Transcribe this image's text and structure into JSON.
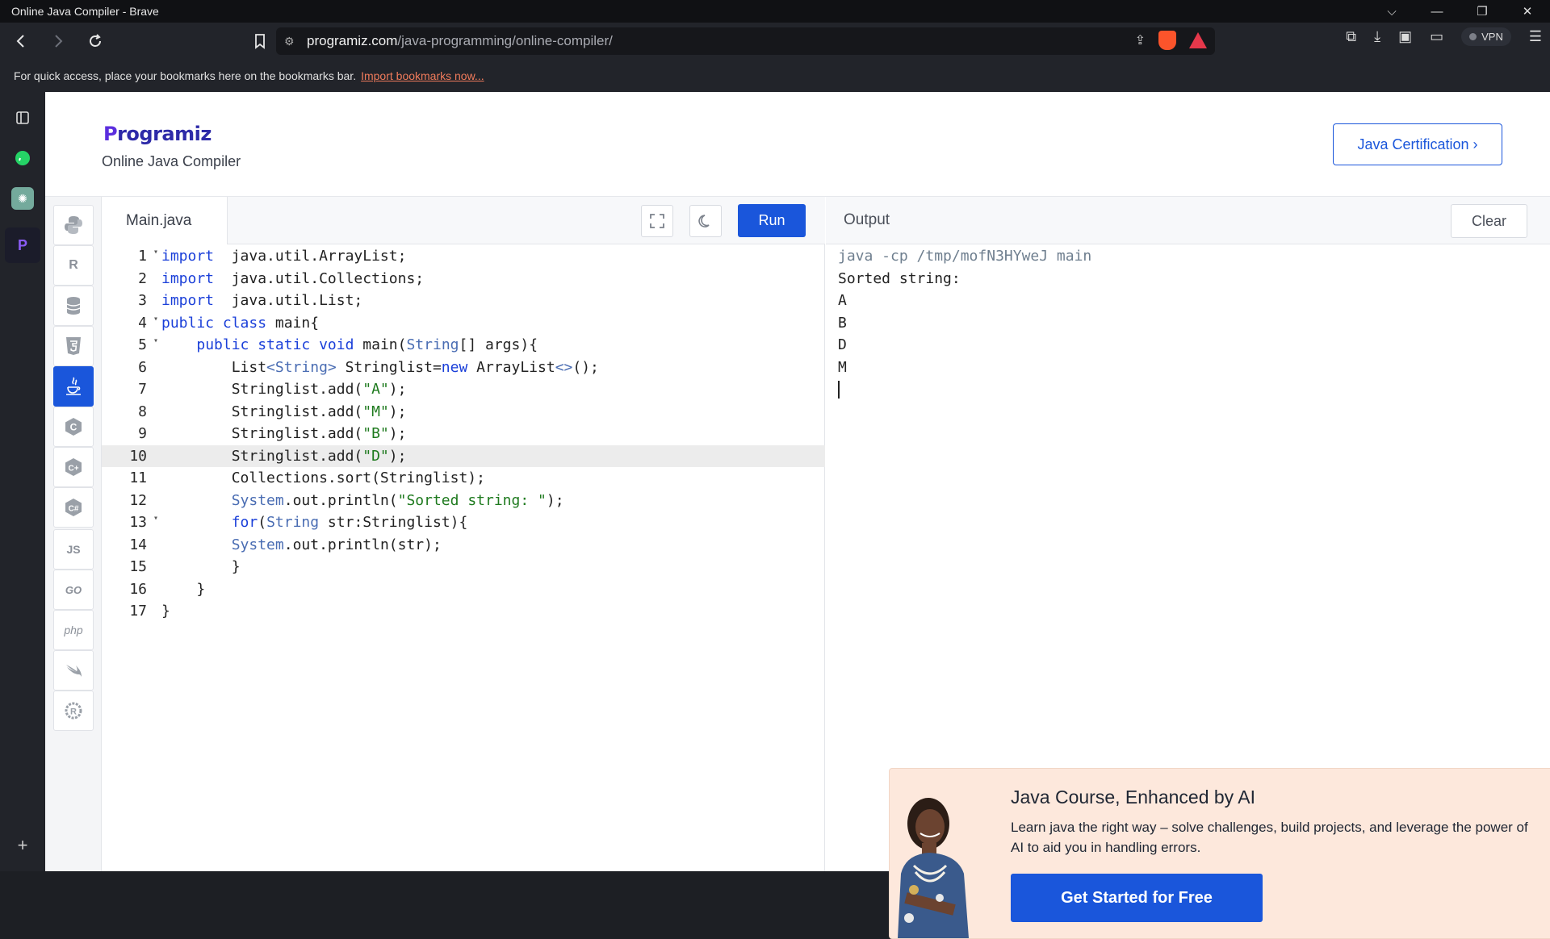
{
  "window": {
    "title": "Online Java Compiler - Brave",
    "controls": {
      "minimize": "—",
      "restore": "❐",
      "close": "✕",
      "tabs": "⌵"
    }
  },
  "toolbar": {
    "back_icon": "back-arrow-icon",
    "url_domain": "programiz.com",
    "url_path": "/java-programming/online-compiler/",
    "vpn_label": "VPN"
  },
  "bookmarks_bar": {
    "text": "For quick access, place your bookmarks here on the bookmarks bar.",
    "link": "Import bookmarks now..."
  },
  "header": {
    "logo_first": "P",
    "logo_rest": "rogramiz",
    "subtitle": "Online Java Compiler",
    "cert_button": "Java Certification ›"
  },
  "languages": [
    "python",
    "r",
    "sql",
    "html",
    "java",
    "c",
    "cpp",
    "csharp",
    "JS",
    "GO",
    "php",
    "swift",
    "rust"
  ],
  "editor": {
    "file_tab": "Main.java",
    "run_label": "Run",
    "current_line": 10,
    "lines": [
      {
        "n": "1",
        "fold": true
      },
      {
        "n": "2",
        "fold": false
      },
      {
        "n": "3",
        "fold": false
      },
      {
        "n": "4",
        "fold": true
      },
      {
        "n": "5",
        "fold": true
      },
      {
        "n": "6",
        "fold": false
      },
      {
        "n": "7",
        "fold": false
      },
      {
        "n": "8",
        "fold": false
      },
      {
        "n": "9",
        "fold": false
      },
      {
        "n": "10",
        "fold": false
      },
      {
        "n": "11",
        "fold": false
      },
      {
        "n": "12",
        "fold": false
      },
      {
        "n": "13",
        "fold": true
      },
      {
        "n": "14",
        "fold": false
      },
      {
        "n": "15",
        "fold": false
      },
      {
        "n": "16",
        "fold": false
      },
      {
        "n": "17",
        "fold": false
      }
    ],
    "code": [
      [
        [
          "kw",
          "import"
        ],
        [
          "",
          "  java.util.ArrayList;"
        ]
      ],
      [
        [
          "kw",
          "import"
        ],
        [
          "",
          "  java.util.Collections;"
        ]
      ],
      [
        [
          "kw",
          "import"
        ],
        [
          "",
          "  java.util.List;"
        ]
      ],
      [
        [
          "kw",
          "public class"
        ],
        [
          "",
          " main{"
        ]
      ],
      [
        [
          "",
          "    "
        ],
        [
          "kw",
          "public static void"
        ],
        [
          "",
          " main("
        ],
        [
          "ty",
          "String"
        ],
        [
          "",
          "[] args){"
        ]
      ],
      [
        [
          "",
          "        List"
        ],
        [
          "ty",
          "<String>"
        ],
        [
          "",
          " Stringlist="
        ],
        [
          "kw",
          "new"
        ],
        [
          "",
          " ArrayList"
        ],
        [
          "ty",
          "<>"
        ],
        [
          "",
          "();"
        ]
      ],
      [
        [
          "",
          "        Stringlist.add("
        ],
        [
          "str",
          "\"A\""
        ],
        [
          "",
          ");"
        ]
      ],
      [
        [
          "",
          "        Stringlist.add("
        ],
        [
          "str",
          "\"M\""
        ],
        [
          "",
          ");"
        ]
      ],
      [
        [
          "",
          "        Stringlist.add("
        ],
        [
          "str",
          "\"B\""
        ],
        [
          "",
          ");"
        ]
      ],
      [
        [
          "",
          "        Stringlist.add("
        ],
        [
          "str",
          "\"D\""
        ],
        [
          "",
          ");"
        ]
      ],
      [
        [
          "",
          "        Collections.sort(Stringlist);"
        ]
      ],
      [
        [
          "",
          "        "
        ],
        [
          "ty",
          "System"
        ],
        [
          "",
          ".out.println("
        ],
        [
          "str",
          "\"Sorted string: \""
        ],
        [
          "",
          ");"
        ]
      ],
      [
        [
          "",
          "        "
        ],
        [
          "kw",
          "for"
        ],
        [
          "",
          "("
        ],
        [
          "ty",
          "String"
        ],
        [
          "",
          " str:Stringlist){"
        ]
      ],
      [
        [
          "",
          "        "
        ],
        [
          "ty",
          "System"
        ],
        [
          "",
          ".out.println(str);"
        ]
      ],
      [
        [
          "",
          "        }"
        ]
      ],
      [
        [
          "",
          "    }"
        ]
      ],
      [
        [
          "",
          "}"
        ]
      ]
    ]
  },
  "output": {
    "label": "Output",
    "clear_label": "Clear",
    "command": "java -cp /tmp/mofN3HYweJ main",
    "lines": [
      "Sorted string:",
      "A",
      "B",
      "D",
      "M"
    ]
  },
  "ad": {
    "title": "Java Course, Enhanced by AI",
    "description": "Learn java the right way – solve challenges, build projects, and leverage the power of AI to aid you in handling errors.",
    "button": "Get Started for Free",
    "close": "✕"
  }
}
